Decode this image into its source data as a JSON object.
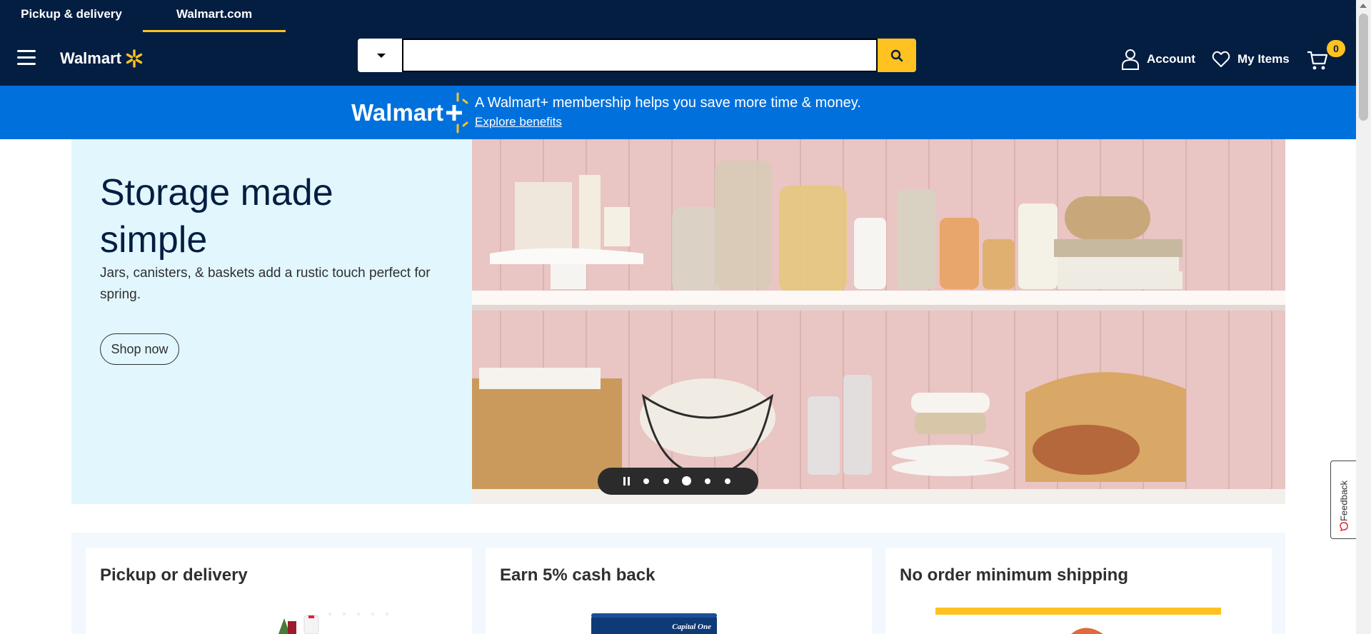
{
  "top_tabs": [
    {
      "label": "Pickup & delivery"
    },
    {
      "label": "Walmart.com"
    }
  ],
  "header": {
    "logo_text": "Walmart",
    "search_placeholder": "",
    "search_value": "",
    "account_label": "Account",
    "my_items_label": "My Items",
    "cart_count": "0"
  },
  "colors": {
    "navy": "#041e42",
    "spark_yellow": "#ffc220",
    "blue": "#0071dc",
    "hero_bg": "#e2f7fd"
  },
  "plus_banner": {
    "logo_text": "Walmart+",
    "message": "A Walmart+ membership helps you save more time & money.",
    "link": "Explore benefits"
  },
  "hero": {
    "title": "Storage made simple",
    "subtitle": "Jars, canisters, & baskets add a rustic touch perfect for spring.",
    "cta": "Shop now",
    "carousel_slides": 5,
    "carousel_active": 3
  },
  "cards": [
    {
      "title": "Pickup or delivery"
    },
    {
      "title": "Earn 5% cash back"
    },
    {
      "title": "No order minimum shipping"
    }
  ],
  "feedback": {
    "label": "Feedback"
  }
}
